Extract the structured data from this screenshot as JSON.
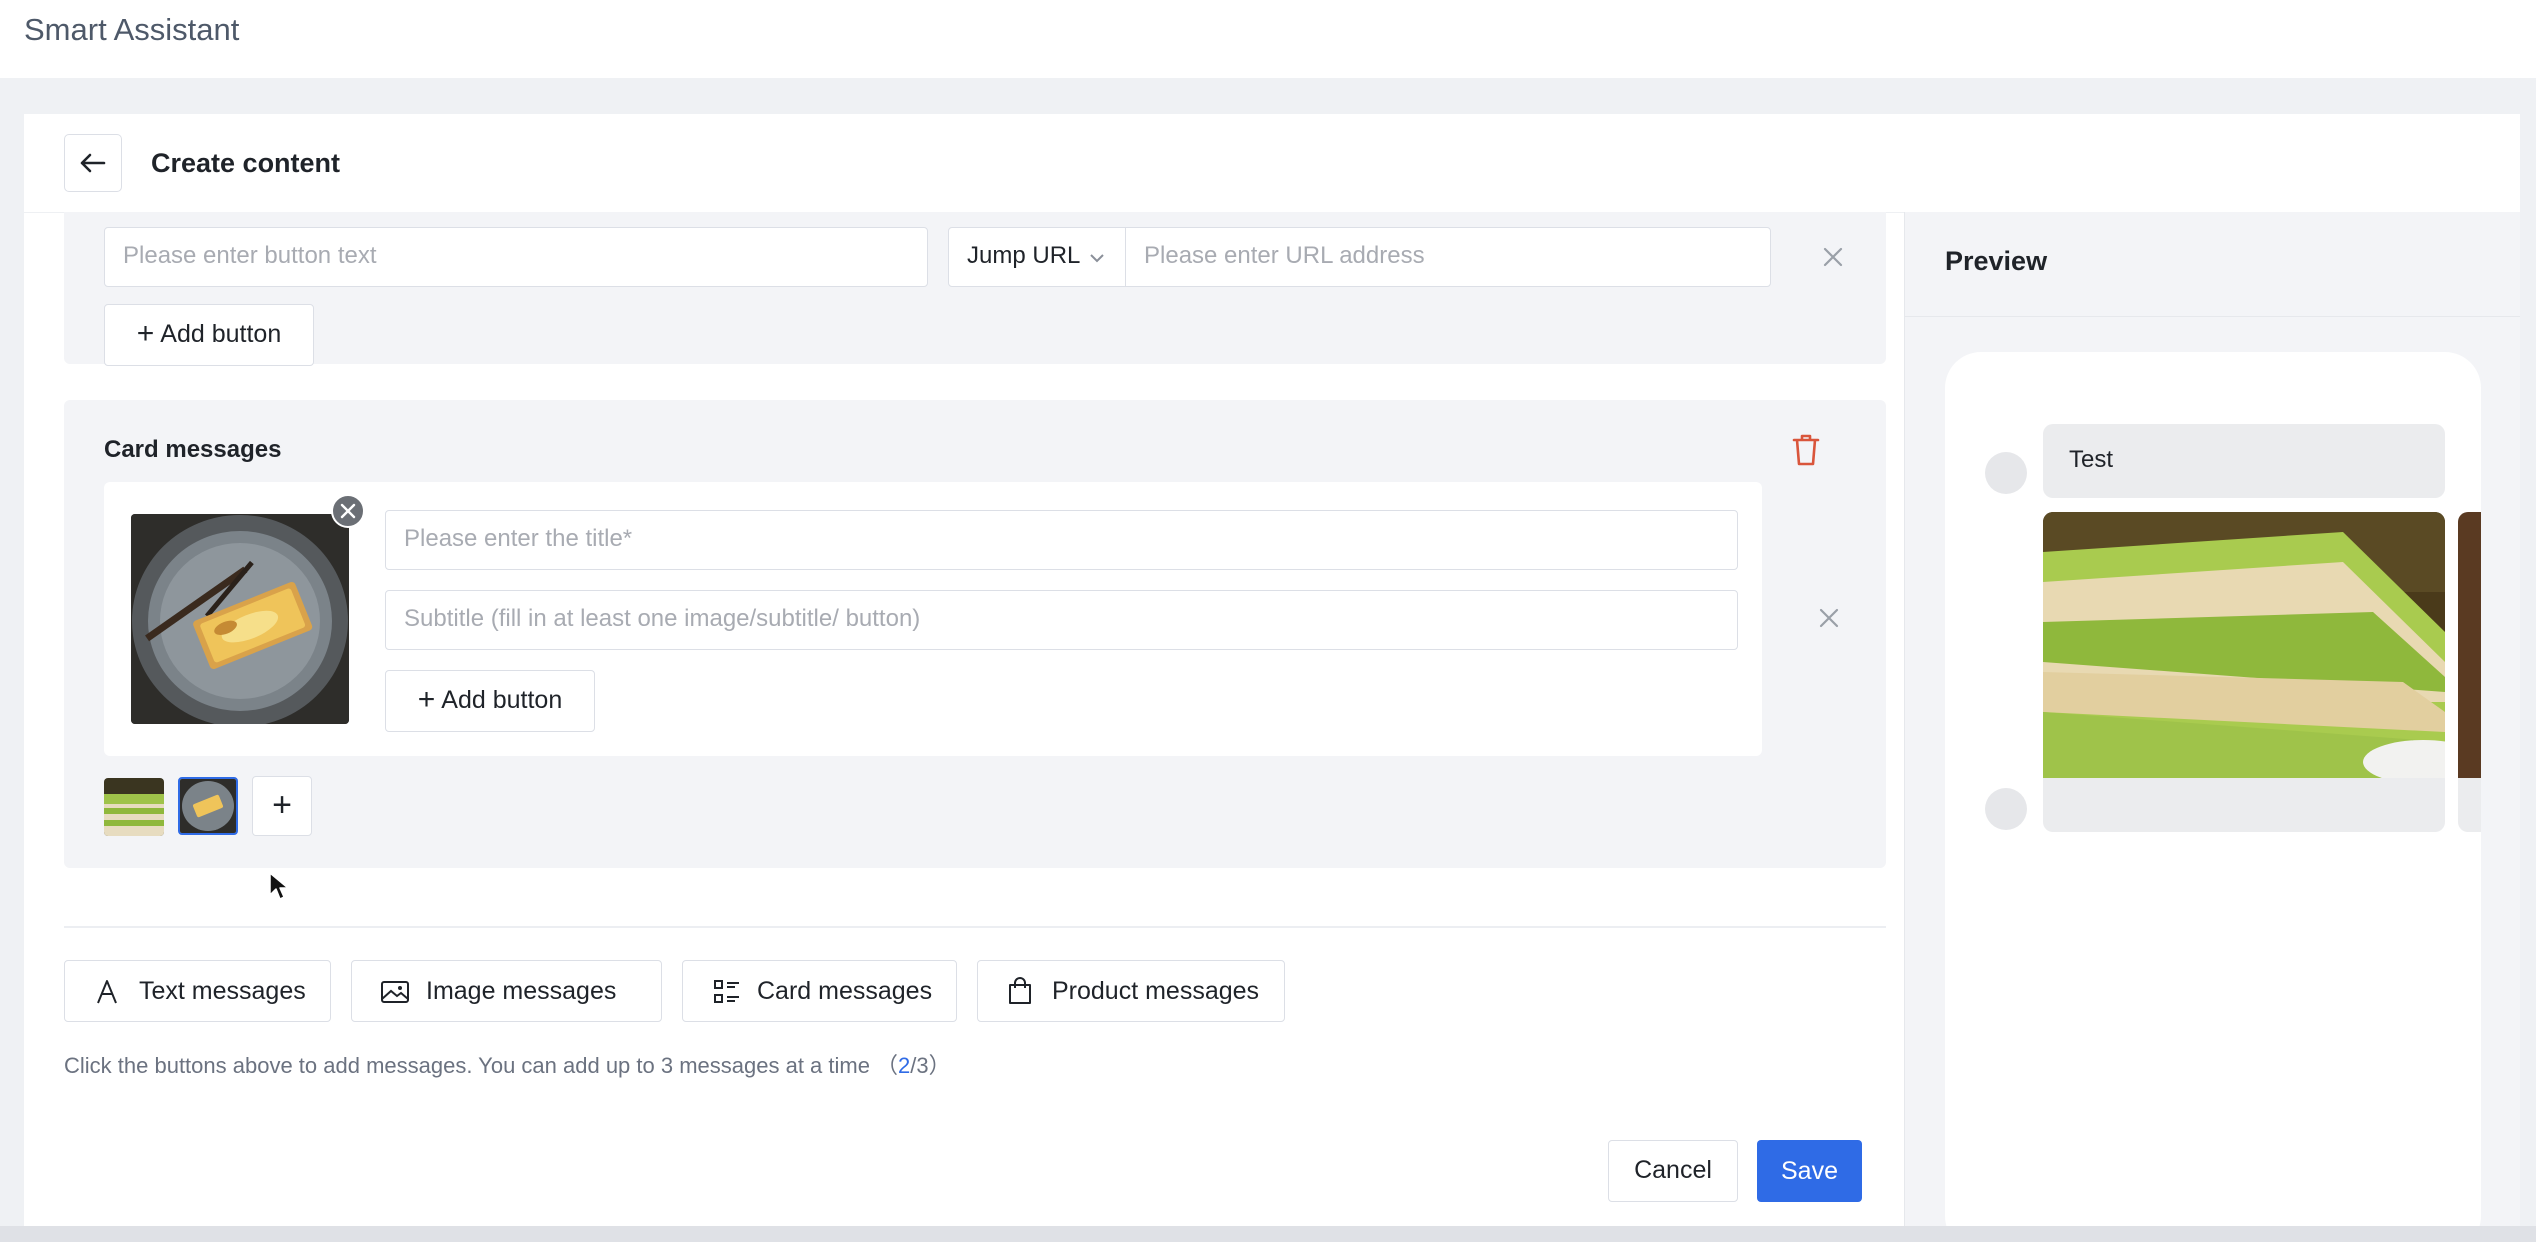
{
  "app": {
    "title": "Smart Assistant"
  },
  "header": {
    "title": "Create content",
    "back_icon": "arrow-left-icon"
  },
  "button_row": {
    "text_placeholder": "Please enter button text",
    "action_select": "Jump URL",
    "url_placeholder": "Please enter URL address",
    "add_button_label": "Add button"
  },
  "card_section": {
    "title": "Card messages",
    "title_placeholder": "Please enter the title*",
    "subtitle_placeholder": "Subtitle (fill in at least one image/subtitle/ button)",
    "add_button_label": "Add button",
    "delete_color": "#d9553b"
  },
  "message_types": [
    {
      "label": "Text messages",
      "icon": "text-icon"
    },
    {
      "label": "Image messages",
      "icon": "image-icon"
    },
    {
      "label": "Card messages",
      "icon": "list-icon"
    },
    {
      "label": "Product messages",
      "icon": "shopping-bag-icon"
    }
  ],
  "hint": {
    "text": "Click the buttons above to add messages. You can add up to 3 messages at a time",
    "open": "（",
    "current": "2",
    "sep": "/",
    "max": "3",
    "close": "）"
  },
  "footer": {
    "cancel_label": "Cancel",
    "save_label": "Save",
    "primary_color": "#2f6be6"
  },
  "preview": {
    "title": "Preview",
    "bubble_text": "Test"
  }
}
